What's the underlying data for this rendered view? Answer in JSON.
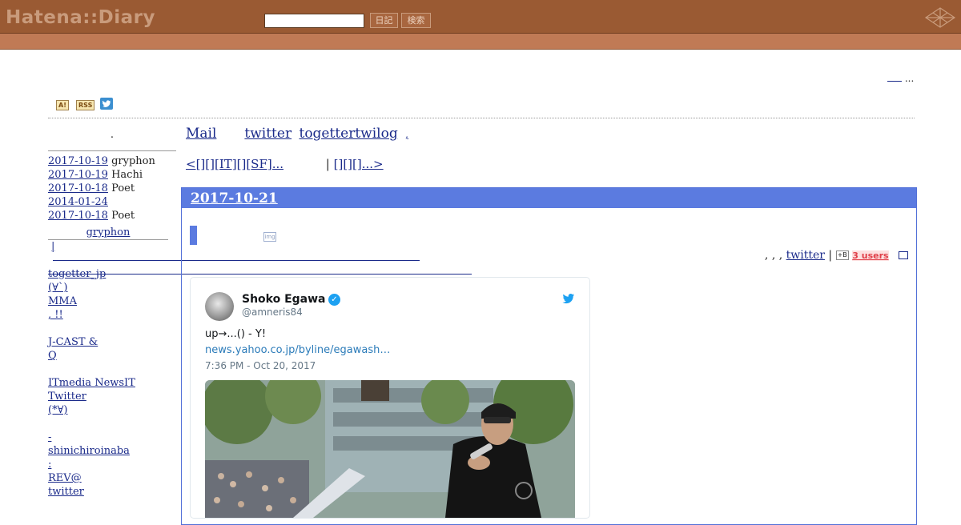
{
  "header": {
    "logo": "Hatena::Diary",
    "search_value": "",
    "diary_button": "日記",
    "search_button": "検索"
  },
  "topright": {
    "trail": "..."
  },
  "badges": {
    "a": "A!",
    "rss": "RSS"
  },
  "sidebar": {
    "title": ".",
    "recent": [
      {
        "date": "2017-10-19",
        "text": "gryphon"
      },
      {
        "date": "2017-10-19",
        "text": "Hachi"
      },
      {
        "date": "2017-10-18",
        "text": "Poet"
      },
      {
        "date": "2014-01-24",
        "text": ""
      },
      {
        "date": "2017-10-18",
        "text": "Poet"
      }
    ],
    "gryphon_title": "gryphon",
    "pipe_link": "|",
    "links_1": [
      "togetter_jp",
      "(∀`)",
      "MMA",
      ", !!"
    ],
    "links_2": [
      "J-CAST &",
      "Q"
    ],
    "links_3": [
      "ITmedia NewsIT",
      "Twitter",
      "(*∀)"
    ],
    "links_4": [
      "-",
      "shinichiroinaba",
      ":",
      "REV@",
      "twitter"
    ]
  },
  "main": {
    "links": [
      "Mail",
      "twitter",
      "togettertwilog",
      ","
    ],
    "nav_prev": "<[][][IT][][SF]...",
    "nav_sep": "|",
    "nav_next": "[][][]...>",
    "day": {
      "date": "2017-10-21",
      "img_icon": "img",
      "tags": ", , ,",
      "tag_twitter": "twitter",
      "tag_sep": "|",
      "hatebu": "+B",
      "users": "3 users"
    }
  },
  "tweet": {
    "name": "Shoko Egawa",
    "handle": "@amneris84",
    "text": "up→...() - Y!",
    "link": "news.yahoo.co.jp/byline/egawash…",
    "date": "7:36 PM - Oct 20, 2017"
  },
  "colors": {
    "topbar": "#9a5a33",
    "subbar": "#c07a55",
    "day_header": "#5b7be0",
    "link": "#1a2a8a",
    "tweet_link": "#2b7bb9"
  }
}
